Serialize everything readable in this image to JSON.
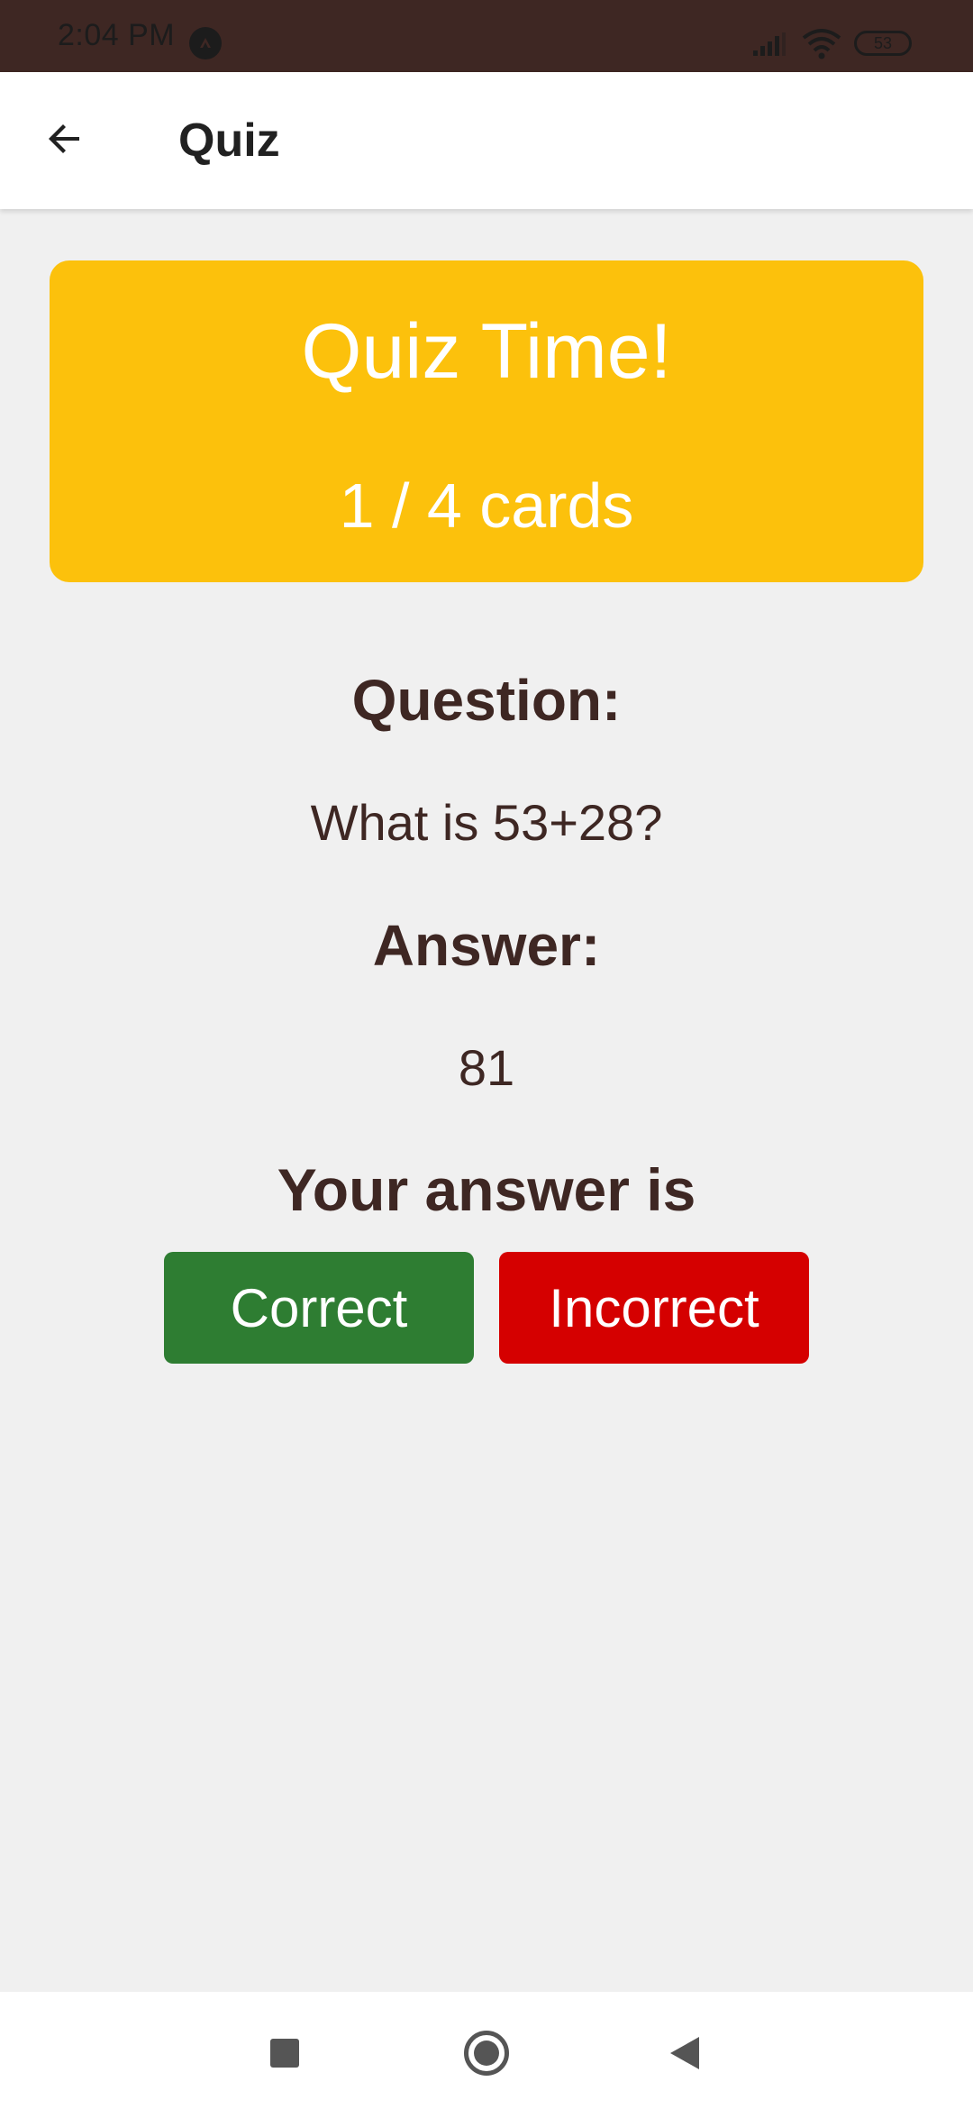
{
  "status_bar": {
    "time": "2:04 PM",
    "battery": "53",
    "icons": [
      "app-notification-icon",
      "signal-icon",
      "wifi-icon",
      "battery-icon"
    ]
  },
  "app_bar": {
    "title": "Quiz",
    "back_icon": "arrow-back-icon"
  },
  "banner": {
    "title": "Quiz Time!",
    "progress": "1 / 4 cards",
    "color": "#fcc10c"
  },
  "card": {
    "question_label": "Question:",
    "question_text": "What is 53+28?",
    "answer_label": "Answer:",
    "answer_text": "81",
    "prompt": "Your answer is"
  },
  "buttons": {
    "correct_label": "Correct",
    "correct_color": "#2e7d32",
    "incorrect_label": "Incorrect",
    "incorrect_color": "#d50000"
  },
  "nav_bar": {
    "icons": [
      "recents-icon",
      "home-icon",
      "back-icon"
    ]
  },
  "colors": {
    "status_bar": "#3e2723",
    "text": "#3e2723",
    "background": "#f0f0f0"
  }
}
